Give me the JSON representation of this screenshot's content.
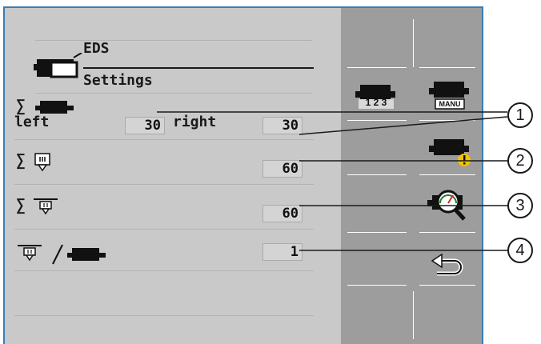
{
  "header": {
    "title": "EDS",
    "subtitle": "Settings"
  },
  "rows": {
    "row1": {
      "left_label": "left",
      "left_value": "30",
      "right_label": "right",
      "right_value": "30"
    },
    "row2": {
      "value": "60"
    },
    "row3": {
      "value": "60"
    },
    "row4": {
      "value": "1"
    }
  },
  "softkeys": {
    "counter_label": "1 2 3",
    "manual_label": "MANU"
  },
  "callouts": [
    "1",
    "2",
    "3",
    "4"
  ],
  "colors": {
    "frame": "#3a7db3",
    "panel": "#c9c9c9",
    "softkey_bar": "#9d9d9d",
    "warning": "#f2c200"
  }
}
